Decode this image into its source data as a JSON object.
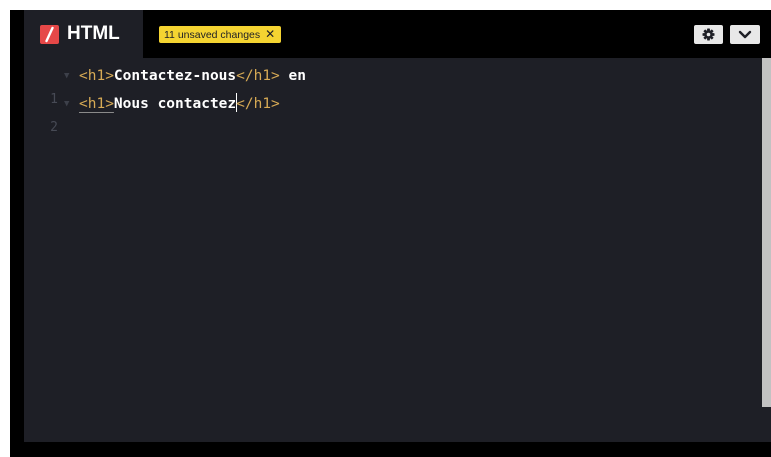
{
  "header": {
    "title": "HTML",
    "unsaved_badge": "11 unsaved changes",
    "unsaved_close": "✕"
  },
  "icons": {
    "logo": "html-slash-icon",
    "settings": "gear-icon",
    "menu": "chevron-down-icon"
  },
  "editor": {
    "lines": [
      {
        "number": "1",
        "open_tag": "<h1>",
        "text": "Contactez-nous",
        "close_tag": "</h1>",
        "trailing": " en"
      },
      {
        "number": "2",
        "open_tag": "<h1>",
        "text": "Nous contactez",
        "close_tag": "</h1>",
        "trailing": ""
      }
    ]
  },
  "colors": {
    "editor_bg": "#1e1f26",
    "header_bg": "#000000",
    "logo_red": "#e64848",
    "badge_yellow": "#f5d431",
    "tag_color": "#d7aa55",
    "text_color": "#ffffff"
  }
}
